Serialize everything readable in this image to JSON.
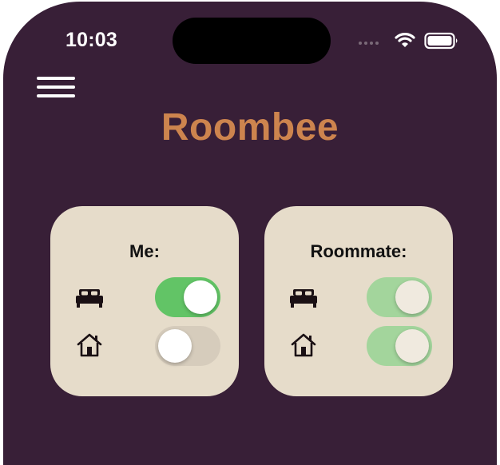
{
  "status_bar": {
    "time": "10:03"
  },
  "header": {
    "menu_icon": "hamburger-menu-icon",
    "title": "Roombee"
  },
  "cards": [
    {
      "title": "Me:",
      "rows": [
        {
          "icon": "bed-icon",
          "state": "on",
          "enabled": true
        },
        {
          "icon": "home-icon",
          "state": "off",
          "enabled": true
        }
      ]
    },
    {
      "title": "Roommate:",
      "rows": [
        {
          "icon": "bed-icon",
          "state": "on",
          "enabled": false
        },
        {
          "icon": "home-icon",
          "state": "on",
          "enabled": false
        }
      ]
    }
  ],
  "colors": {
    "background": "#381f37",
    "title": "#cd844e",
    "card": "#e6dcca",
    "toggle_on": "#62c466",
    "toggle_on_disabled": "#a3d59c",
    "toggle_off": "#d6ccbc",
    "knob": "#ffffff",
    "knob_disabled": "#f0eadf"
  }
}
